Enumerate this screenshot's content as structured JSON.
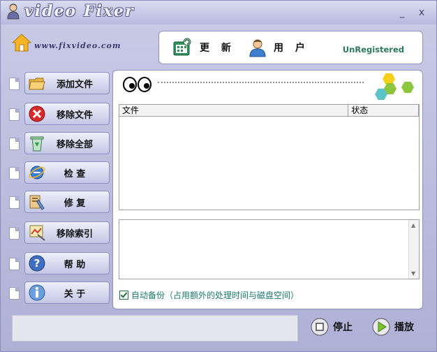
{
  "window": {
    "title": "video Fixer",
    "minimize": "_",
    "close": "x",
    "url": "www.fixvideo.com"
  },
  "toolbar": {
    "update_label": "更 新",
    "user_label": "用 户",
    "registration_status": "UnRegistered"
  },
  "sidebar": {
    "items": [
      {
        "label": "添加文件",
        "icon": "folder-icon"
      },
      {
        "label": "移除文件",
        "icon": "remove-icon"
      },
      {
        "label": "移除全部",
        "icon": "recycle-bin-icon"
      },
      {
        "label": "检  查",
        "icon": "ie-check-icon"
      },
      {
        "label": "修  复",
        "icon": "repair-icon"
      },
      {
        "label": "移除索引",
        "icon": "remove-index-icon"
      },
      {
        "label": "帮  助",
        "icon": "help-icon"
      },
      {
        "label": "关  于",
        "icon": "info-icon"
      }
    ]
  },
  "file_table": {
    "columns": [
      "文件",
      "状态"
    ],
    "rows": []
  },
  "options": {
    "auto_backup_checked": true,
    "auto_backup_label": "自动备份（占用额外的处理时间与磁盘空间）"
  },
  "footer": {
    "status_text": "",
    "stop_label": "停止",
    "play_label": "播放"
  },
  "colors": {
    "window_bg": "#b7bade",
    "accent_green": "#2a7a62",
    "hex_yellow": "#f5cf1a",
    "hex_green": "#8cc63f",
    "hex_teal": "#5ec3c9"
  }
}
